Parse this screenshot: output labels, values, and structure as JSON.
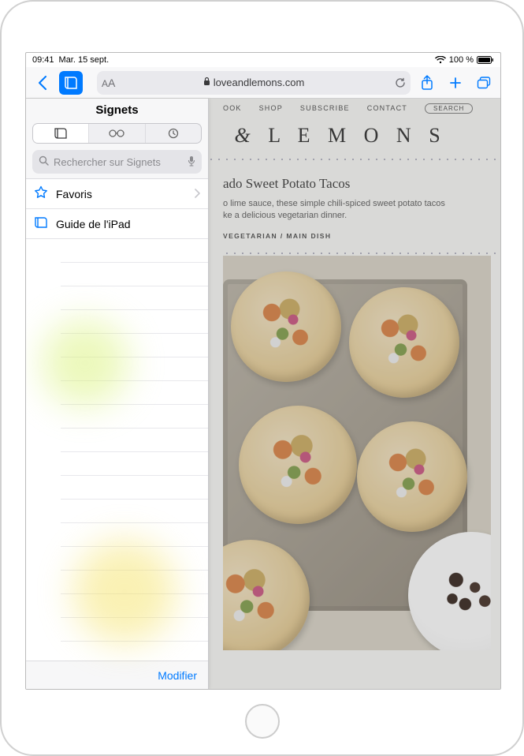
{
  "status": {
    "time": "09:41",
    "date": "Mar. 15 sept.",
    "battery_text": "100 %"
  },
  "toolbar": {
    "url_display": "loveandlemons.com"
  },
  "sidebar": {
    "title": "Signets",
    "search_placeholder": "Rechercher sur Signets",
    "items": [
      {
        "label": "Favoris",
        "icon": "star-outline-icon",
        "disclosure": true
      },
      {
        "label": "Guide de l'iPad",
        "icon": "book-icon",
        "disclosure": false
      }
    ],
    "footer_edit": "Modifier"
  },
  "webpage": {
    "nav": [
      "OOK",
      "SHOP",
      "SUBSCRIBE",
      "CONTACT"
    ],
    "nav_search": "SEARCH",
    "site_title_suffix": "L E M O N S",
    "recipe_title_suffix": "ado Sweet Potato Tacos",
    "recipe_desc_line1": "o lime sauce, these simple chili-spiced sweet potato tacos",
    "recipe_desc_line2": "ke a delicious vegetarian dinner.",
    "categories": "VEGETARIAN / MAIN DISH"
  }
}
